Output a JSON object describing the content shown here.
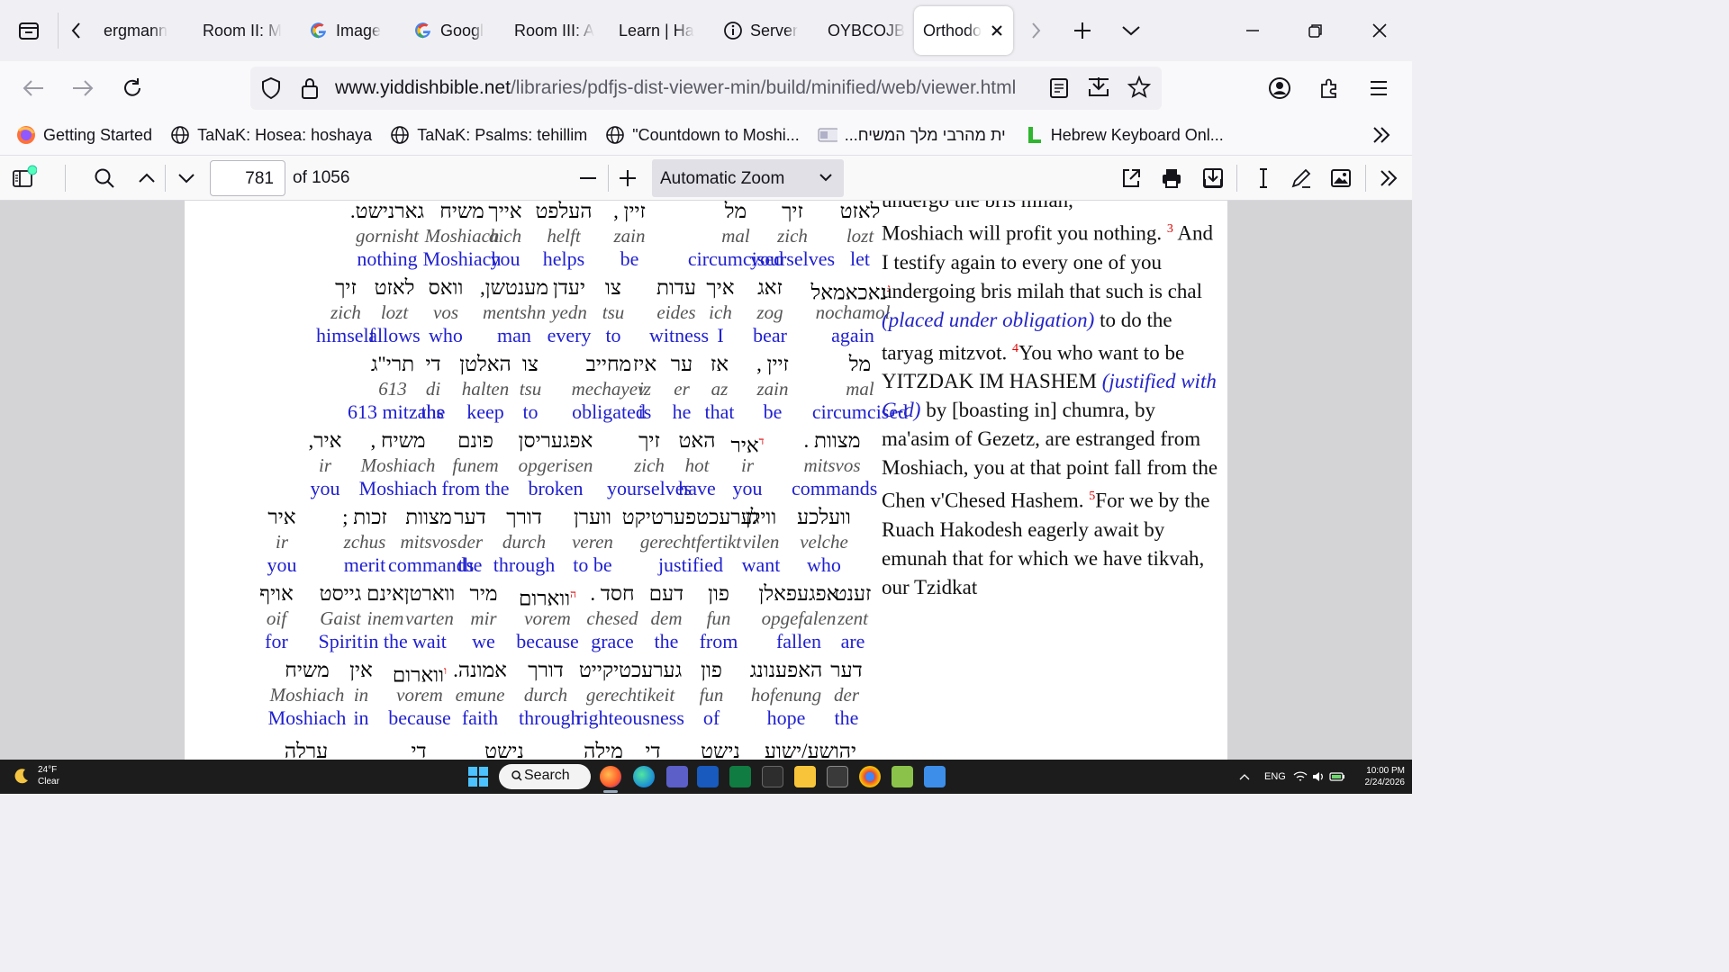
{
  "tabs": [
    {
      "label": "ergmann",
      "icon": "page-icon"
    },
    {
      "label": "Room II: M",
      "icon": "page-icon"
    },
    {
      "label": "Image",
      "icon": "google-icon"
    },
    {
      "label": "Googl",
      "icon": "google-icon"
    },
    {
      "label": "Room III: A",
      "icon": "page-icon"
    },
    {
      "label": "Learn | Ha",
      "icon": "page-icon"
    },
    {
      "label": "Server",
      "icon": "info-icon"
    },
    {
      "label": "OYBCOJBC",
      "icon": "page-icon"
    },
    {
      "label": "Orthodo",
      "icon": "page-icon",
      "active": true
    }
  ],
  "url": {
    "host": "www.yiddishbible.net",
    "path": "/libraries/pdfjs-dist-viewer-min/build/minified/web/viewer.html"
  },
  "bookmarks": [
    {
      "label": "Getting Started",
      "icon": "firefox-icon"
    },
    {
      "label": "TaNaK: Hosea: hoshaya",
      "icon": "globe-icon"
    },
    {
      "label": "TaNaK: Psalms: tehillim",
      "icon": "globe-icon"
    },
    {
      "label": "\"Countdown to Moshi...",
      "icon": "globe-icon"
    },
    {
      "label": "...ית מהרבי מלך המשיח",
      "icon": "card-icon"
    },
    {
      "label": "Hebrew Keyboard Onl...",
      "icon": "l-icon"
    }
  ],
  "pdf": {
    "page": "781",
    "page_count": "of 1056",
    "zoom": "Automatic Zoom"
  },
  "interlinear": [
    [
      {
        "h": "לאזט",
        "t": "lozt",
        "e": "let"
      },
      {
        "h": "זיך",
        "t": "zich",
        "e": "yourselves"
      },
      {
        "h": "מל",
        "t": "mal",
        "e": "circumcised"
      },
      {
        "h": "זיין ,",
        "t": "zain",
        "e": "be"
      },
      {
        "h": "העלפט",
        "t": "helft",
        "e": "helps"
      },
      {
        "h": "אייך",
        "t": "aich",
        "e": "you"
      },
      {
        "h": "משיח",
        "t": "Moshiach",
        "e": "Moshiach"
      },
      {
        "h": "גארנישט.",
        "t": "gornisht",
        "e": "nothing"
      }
    ],
    [
      {
        "h": "נאכאמאל",
        "t": "nochamol",
        "e": "again",
        "v": "ג"
      },
      {
        "h": "זאג",
        "t": "zog",
        "e": "bear"
      },
      {
        "h": "איך",
        "t": "ich",
        "e": "I"
      },
      {
        "h": "עדות",
        "t": "eides",
        "e": "witness"
      },
      {
        "h": "צו",
        "t": "tsu",
        "e": "to"
      },
      {
        "h": "יעדן",
        "t": "yedn",
        "e": "every"
      },
      {
        "h": "מענטשן,",
        "t": "mentshn",
        "e": "man"
      },
      {
        "h": "וואס",
        "t": "vos",
        "e": "who"
      },
      {
        "h": "לאזט",
        "t": "lozt",
        "e": "allows"
      },
      {
        "h": "זיך",
        "t": "zich",
        "e": "himself"
      }
    ],
    [
      {
        "h": "מל",
        "t": "mal",
        "e": "circumcised"
      },
      {
        "h": "זיין ,",
        "t": "zain",
        "e": "be"
      },
      {
        "h": "אז",
        "t": "az",
        "e": "that"
      },
      {
        "h": "ער",
        "t": "er",
        "e": "he"
      },
      {
        "h": "איז",
        "t": "iz",
        "e": "is"
      },
      {
        "h": "מחייב",
        "t": "mechayev",
        "e": "obligated"
      },
      {
        "h": "צו",
        "t": "tsu",
        "e": "to"
      },
      {
        "h": "האלטן",
        "t": "halten",
        "e": "keep"
      },
      {
        "h": "די",
        "t": "di",
        "e": "the"
      },
      {
        "h": "תרי\"ג",
        "t": "613",
        "e": "613 mitzahs"
      }
    ],
    [
      {
        "h": "מצוות .",
        "t": "mitsvos",
        "e": "commands"
      },
      {
        "h": "איר",
        "t": "ir",
        "e": "you",
        "v": "ד"
      },
      {
        "h": "האט",
        "t": "hot",
        "e": "have"
      },
      {
        "h": "זיך",
        "t": "zich",
        "e": "yourselves"
      },
      {
        "h": "אפגעריסן",
        "t": "opgerisen",
        "e": "broken"
      },
      {
        "h": "פונם",
        "t": "funem",
        "e": "from the"
      },
      {
        "h": "משיח ,",
        "t": "Moshiach",
        "e": "Moshiach"
      },
      {
        "h": "איר,",
        "t": "ir",
        "e": "you"
      }
    ],
    [
      {
        "h": "וועלכע",
        "t": "velche",
        "e": "who"
      },
      {
        "h": "ווילן",
        "t": "vilen",
        "e": "want"
      },
      {
        "h": "גערעכטפערטיקט",
        "t": "gerechtfertikt",
        "e": "justified"
      },
      {
        "h": "ווערן",
        "t": "veren",
        "e": "to be"
      },
      {
        "h": "דורך",
        "t": "durch",
        "e": "through"
      },
      {
        "h": "דער",
        "t": "der",
        "e": "the"
      },
      {
        "h": "מצוות",
        "t": "mitsvos",
        "e": "commands"
      },
      {
        "h": "זכות ;",
        "t": "zchus",
        "e": "merit"
      },
      {
        "h": "איר",
        "t": "ir",
        "e": "you"
      }
    ],
    [
      {
        "h": "זענט",
        "t": "zent",
        "e": "are"
      },
      {
        "h": "אפגעפאלן",
        "t": "opgefalen",
        "e": "fallen"
      },
      {
        "h": "פון",
        "t": "fun",
        "e": "from"
      },
      {
        "h": "דעם",
        "t": "dem",
        "e": "the"
      },
      {
        "h": "חסד .",
        "t": "chesed",
        "e": "grace"
      },
      {
        "h": "ווארום",
        "t": "vorem",
        "e": "because",
        "v": "ה"
      },
      {
        "h": "מיר",
        "t": "mir",
        "e": "we"
      },
      {
        "h": "ווארטן",
        "t": "varten",
        "e": "wait"
      },
      {
        "h": "אינם",
        "t": "inem",
        "e": "in the"
      },
      {
        "h": "גייסט",
        "t": "Gaist",
        "e": "Spirit"
      },
      {
        "h": "אויף",
        "t": "oif",
        "e": "for"
      }
    ],
    [
      {
        "h": "דער",
        "t": "der",
        "e": "the"
      },
      {
        "h": "האפענונג",
        "t": "hofenung",
        "e": "hope"
      },
      {
        "h": "פון",
        "t": "fun",
        "e": "of"
      },
      {
        "h": "גערעכטיקייט",
        "t": "gerechtikeit",
        "e": "righteousness"
      },
      {
        "h": "דורך",
        "t": "durch",
        "e": "through"
      },
      {
        "h": "אמונה.",
        "t": "emune",
        "e": "faith"
      },
      {
        "h": "ווארום",
        "t": "vorem",
        "e": "because",
        "v": "ו"
      },
      {
        "h": "אין",
        "t": "in",
        "e": "in"
      },
      {
        "h": "משיח",
        "t": "Moshiach",
        "e": "Moshiach"
      }
    ],
    [
      {
        "h": "יהושע/ישוע",
        "t": "",
        "e": ""
      },
      {
        "h": "נישט",
        "t": "",
        "e": ""
      },
      {
        "h": "די",
        "t": "",
        "e": ""
      },
      {
        "h": "מילה",
        "t": "",
        "e": ""
      },
      {
        "h": "נישט",
        "t": "",
        "e": ""
      },
      {
        "h": "די",
        "t": "",
        "e": ""
      },
      {
        "h": "ערלה",
        "t": "",
        "e": ""
      }
    ]
  ],
  "english": {
    "top_cut": "undergo the bris milah,",
    "p1": "Moshiach will profit you nothing.",
    "v3": "3",
    "p2": "And I testify again to every one of you undergoing bris milah that such is chal",
    "p2_it": "(placed under obligation)",
    "p3": "to do the taryag mitzvot.",
    "v4": "4",
    "p4": "You who want to be YITZDAK IM HASHEM",
    "p4_it": "(justified with G-d)",
    "p5": "by [boasting in] chumra, by ma'asim of Gezetz, are estranged from Moshiach, you at that point fall from the Chen v'Chesed Hashem.",
    "v5": "5",
    "p6": "For we by the Ruach Hakodesh eagerly await by emunah that for which we have tikvah, our Tzidkat"
  },
  "taskbar": {
    "temp": "24°F",
    "cond": "Clear",
    "search": "Search",
    "lang": "ENG",
    "time": "10:00 PM",
    "date": "2/24/2026"
  }
}
